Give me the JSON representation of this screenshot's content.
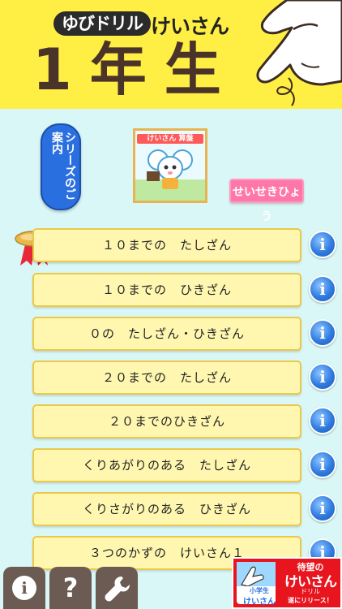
{
  "header": {
    "brand": "ゆびドリル",
    "subtitle": "けいさん",
    "grade": "1年生"
  },
  "series_button": "シリーズのご案内",
  "thumbnail_label": "けいさん 算盤",
  "record_button": "せいせきひょう",
  "lessons": [
    {
      "label": "１０までの　たしざん"
    },
    {
      "label": "１０までの　ひきざん"
    },
    {
      "label": "０の　たしざん・ひきざん"
    },
    {
      "label": "２０までの　たしざん"
    },
    {
      "label": "２０までのひきざん"
    },
    {
      "label": "くりあがりのある　たしざん"
    },
    {
      "label": "くりさがりのある　ひきざん"
    },
    {
      "label": "３つのかずの　けいさん１"
    }
  ],
  "info_glyph": "i",
  "toolbar": {
    "info_glyph": "i",
    "help_glyph": "?",
    "settings_icon": "wrench-icon"
  },
  "ad": {
    "line1": "待望の",
    "line2": "けいさん",
    "line3": "ドリル",
    "line4": "遂にリリース！",
    "badge_small": "小学生",
    "badge_big": "けいさん"
  },
  "colors": {
    "header_bg": "#ffee44",
    "content_bg": "#d9f7f6",
    "row_bg": "#fff7b0",
    "accent_blue": "#2a6fe0",
    "accent_pink": "#ff77a8"
  }
}
